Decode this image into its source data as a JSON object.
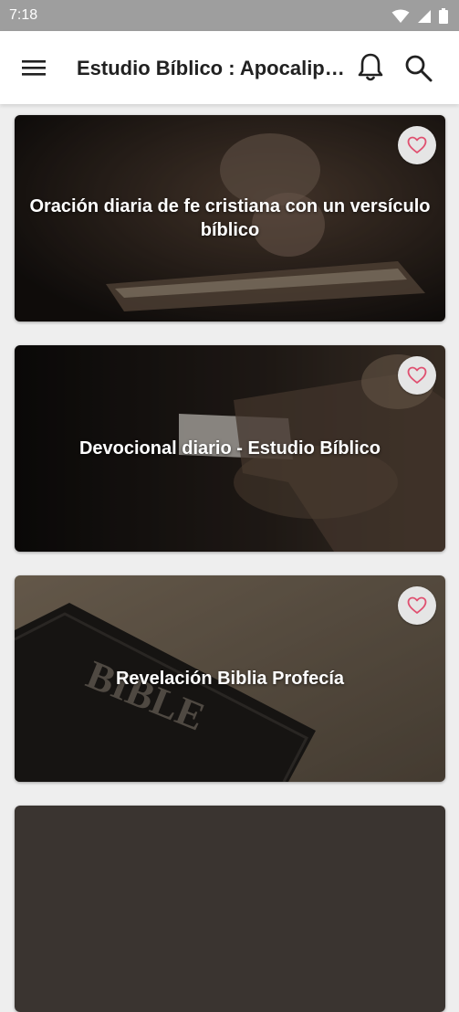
{
  "status_bar": {
    "time": "7:18",
    "icons": [
      "wifi-icon",
      "signal-icon",
      "battery-icon"
    ]
  },
  "app_bar": {
    "title": "Estudio Bíblico : Apocalipsis",
    "menu_icon": "hamburger-menu-icon",
    "notification_icon": "bell-icon",
    "search_icon": "search-icon"
  },
  "cards": [
    {
      "title": "Oración diaria de fe cristiana con un versículo bíblico",
      "favorite_icon": "heart-outline-icon"
    },
    {
      "title": "Devocional diario - Estudio Bíblico",
      "favorite_icon": "heart-outline-icon"
    },
    {
      "title": "Revelación Biblia Profecía",
      "favorite_icon": "heart-outline-icon"
    }
  ],
  "colors": {
    "status_bar": "#9e9e9e",
    "app_bar": "#ffffff",
    "background": "#eeeeee",
    "favorite_icon": "#e05070"
  }
}
